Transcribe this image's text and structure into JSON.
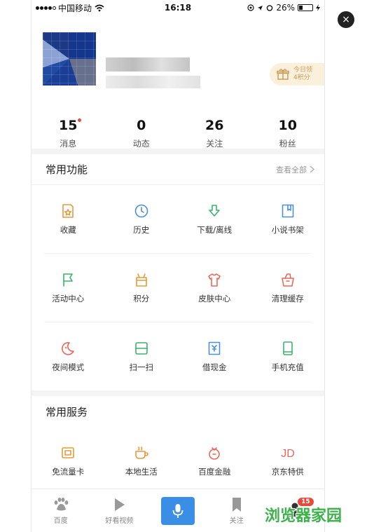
{
  "status_bar": {
    "carrier": "中国移动",
    "time": "16:18",
    "battery": "26%"
  },
  "profile": {
    "gift": {
      "line1": "今日领",
      "line2": "4积分"
    },
    "stats": [
      {
        "value": "15",
        "label": "消息",
        "dot": true
      },
      {
        "value": "0",
        "label": "动态"
      },
      {
        "value": "26",
        "label": "关注"
      },
      {
        "value": "10",
        "label": "粉丝"
      }
    ]
  },
  "common_functions": {
    "title": "常用功能",
    "view_all": "查看全部",
    "items": [
      {
        "label": "收藏",
        "icon": "favorites-icon",
        "color": "#e59b3a"
      },
      {
        "label": "历史",
        "icon": "clock-icon",
        "color": "#4a90d9"
      },
      {
        "label": "下载/离线",
        "icon": "download-icon",
        "color": "#3bb36a"
      },
      {
        "label": "小说书架",
        "icon": "bookshelf-icon",
        "color": "#4a90d9"
      },
      {
        "label": "活动中心",
        "icon": "flag-icon",
        "color": "#3bb36a"
      },
      {
        "label": "积分",
        "icon": "points-box-icon",
        "color": "#e59b3a"
      },
      {
        "label": "皮肤中心",
        "icon": "shirt-icon",
        "color": "#e8685a"
      },
      {
        "label": "清理缓存",
        "icon": "clean-basket-icon",
        "color": "#e8685a"
      },
      {
        "label": "夜间模式",
        "icon": "moon-icon",
        "color": "#e8685a"
      },
      {
        "label": "扫一扫",
        "icon": "scan-icon",
        "color": "#3bb36a"
      },
      {
        "label": "借现金",
        "icon": "cash-loan-icon",
        "color": "#4a90d9"
      },
      {
        "label": "手机充值",
        "icon": "phone-recharge-icon",
        "color": "#3bb36a"
      }
    ]
  },
  "common_services": {
    "title": "常用服务",
    "items": [
      {
        "label": "免流量卡",
        "icon": "data-card-icon",
        "color": "#e59b3a"
      },
      {
        "label": "本地生活",
        "icon": "coffee-icon",
        "color": "#e59b3a"
      },
      {
        "label": "百度金融",
        "icon": "finance-icon",
        "color": "#e8685a"
      },
      {
        "label": "京东特供",
        "icon": "jd-icon",
        "color": "#e8685a",
        "glyph": "JD"
      }
    ]
  },
  "tabbar": [
    {
      "label": "百度",
      "icon": "baidu-paw-icon"
    },
    {
      "label": "好看视频",
      "icon": "play-icon"
    },
    {
      "label": "",
      "icon": "mic-icon"
    },
    {
      "label": "关注",
      "icon": "bookmark-icon"
    },
    {
      "label": "",
      "icon": "person-icon",
      "badge": "15"
    }
  ],
  "close_label": "×",
  "watermark": "浏览器家园"
}
